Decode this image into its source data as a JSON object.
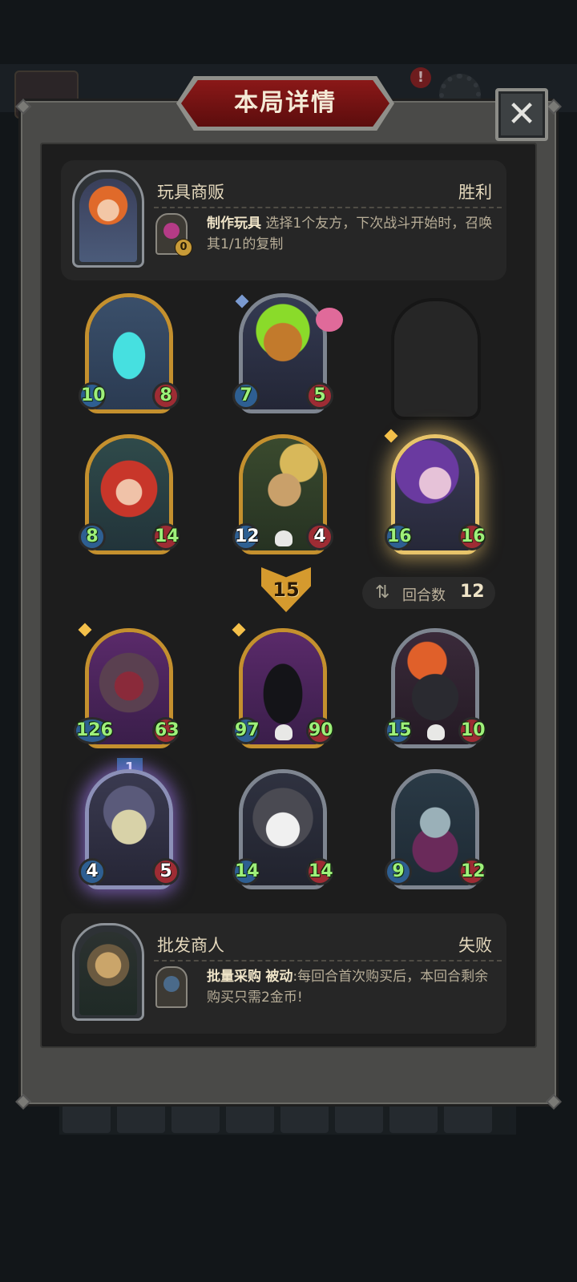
{
  "title": "本局详情",
  "close_label": "✕",
  "background": {
    "alert_badge": "!"
  },
  "player": {
    "name": "玩具商贩",
    "result": "胜利",
    "skill_name": "制作玩具",
    "skill_desc": "选择1个友方，下次战斗开始时，召唤其1/1的复制",
    "skill_badge": "0"
  },
  "opponent": {
    "name": "批发商人",
    "result": "失败",
    "skill_name": "批量采购",
    "skill_type": "被动",
    "skill_desc": ":每回合首次购买后，本回合剩余购买只需2金币!"
  },
  "player_units": [
    {
      "atk": "10",
      "hp": "8",
      "art": "cyan-ghost",
      "frame": "gold"
    },
    {
      "atk": "7",
      "hp": "5",
      "art": "pumpkin-knight",
      "frame": "silver"
    },
    {
      "atk": "8",
      "hp": "14",
      "art": "red-hair-witch",
      "frame": "gold"
    },
    {
      "atk": "12",
      "hp": "4",
      "art": "scarecrow-girl",
      "frame": "gold"
    },
    {
      "atk": "16",
      "hp": "16",
      "art": "sorceress",
      "frame": "gold"
    }
  ],
  "combat": {
    "damage": "15",
    "turn_label": "回合数",
    "turn_value": "12"
  },
  "opponent_units": [
    {
      "atk": "126",
      "hp": "63",
      "art": "werewolf",
      "frame": "gold"
    },
    {
      "atk": "97",
      "hp": "90",
      "art": "hooded-reaper",
      "frame": "gold"
    },
    {
      "atk": "15",
      "hp": "10",
      "art": "flame-bear",
      "frame": "silver"
    },
    {
      "atk": "4",
      "hp": "5",
      "art": "hooded-dog",
      "frame": "silver",
      "tier": "1"
    },
    {
      "atk": "14",
      "hp": "14",
      "art": "husky",
      "frame": "silver"
    },
    {
      "atk": "9",
      "hp": "12",
      "art": "elf-vampire",
      "frame": "silver"
    }
  ]
}
